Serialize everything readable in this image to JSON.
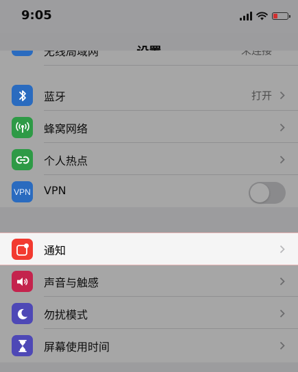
{
  "status_bar": {
    "time": "9:05",
    "battery_level": 0.3
  },
  "nav": {
    "title": "设置"
  },
  "group1": {
    "partial_row": {
      "label": "无线局域网",
      "value": "未连接",
      "icon": "wifi-icon",
      "color": "#2a6bbf"
    },
    "rows": [
      {
        "label": "蓝牙",
        "value": "打开",
        "icon": "bluetooth-icon",
        "color": "#2a6bbf"
      },
      {
        "label": "蜂窝网络",
        "value": "",
        "icon": "cellular-icon",
        "color": "#2e9a46"
      },
      {
        "label": "个人热点",
        "value": "",
        "icon": "hotspot-icon",
        "color": "#2e9a46"
      },
      {
        "label": "VPN",
        "icon_text": "VPN",
        "icon": "vpn-icon",
        "color": "#2a6bbf",
        "toggle_on": false
      }
    ]
  },
  "group2": {
    "rows": [
      {
        "label": "通知",
        "icon": "notifications-icon",
        "color": "#f23a30"
      },
      {
        "label": "声音与触感",
        "icon": "sound-icon",
        "color": "#c4234d"
      },
      {
        "label": "勿扰模式",
        "icon": "moon-icon",
        "color": "#4e48b6"
      },
      {
        "label": "屏幕使用时间",
        "icon": "hourglass-icon",
        "color": "#4e48b6"
      }
    ]
  }
}
